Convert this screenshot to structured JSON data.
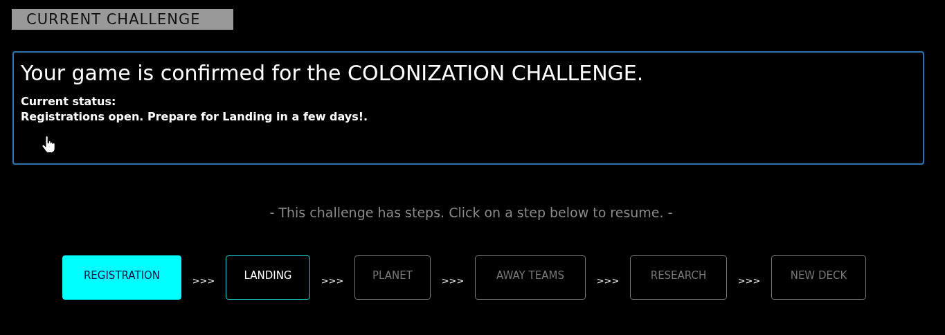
{
  "section_label": "CURRENT CHALLENGE",
  "message": {
    "headline": "Your game is confirmed for the COLONIZATION CHALLENGE.",
    "status_label": "Current status:",
    "status_text": "Registrations open. Prepare for Landing in a few days!."
  },
  "hint": "- This challenge has steps. Click on a step below to resume. -",
  "steps": [
    {
      "label": "REGISTRATION",
      "kind": "active"
    },
    {
      "label": "LANDING",
      "kind": "available",
      "separator": ">>>"
    },
    {
      "label": "PLANET",
      "kind": "locked",
      "separator": ">>>"
    },
    {
      "label": "AWAY TEAMS",
      "kind": "locked",
      "separator": ">>>"
    },
    {
      "label": "RESEARCH",
      "kind": "locked",
      "separator": ">>>"
    },
    {
      "label": "NEW DECK",
      "kind": "locked",
      "separator": ">>>"
    }
  ]
}
